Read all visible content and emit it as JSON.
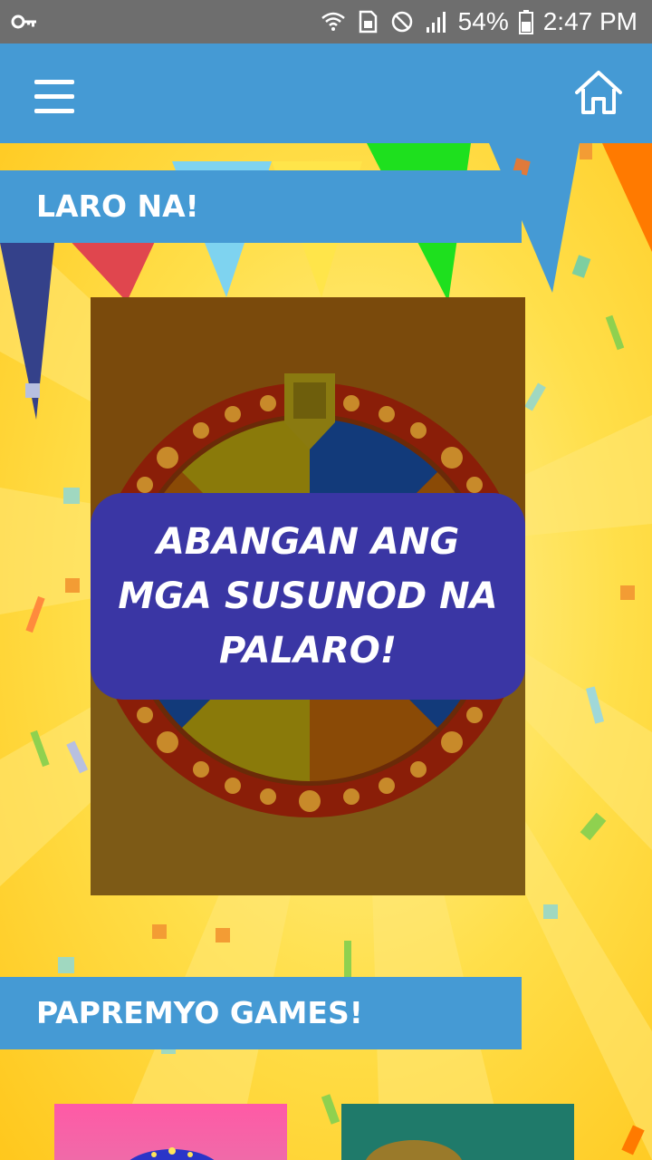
{
  "status_bar": {
    "battery": "54%",
    "time": "2:47 PM",
    "icons": [
      "vpn-key-icon",
      "wifi-icon",
      "sim-card-icon",
      "do-not-disturb-icon",
      "signal-icon",
      "battery-icon"
    ]
  },
  "app_bar": {
    "menu_icon": "hamburger-menu-icon",
    "home_icon": "home-icon",
    "color": "#459ad4"
  },
  "sections": {
    "play": {
      "title": "LARO NA!"
    },
    "prizes": {
      "title": "PAPREMYO GAMES!"
    }
  },
  "game_card": {
    "message": "ABANGAN ANG MGA SUSUNOD NA PALARO!",
    "box_color": "#3a36a4"
  },
  "thumbnails": [
    {
      "name": "prize-game-1"
    },
    {
      "name": "prize-game-2"
    }
  ],
  "colors": {
    "background": "#ffd33a",
    "section_tab": "#459ad4",
    "card": "#7e4e0e"
  }
}
